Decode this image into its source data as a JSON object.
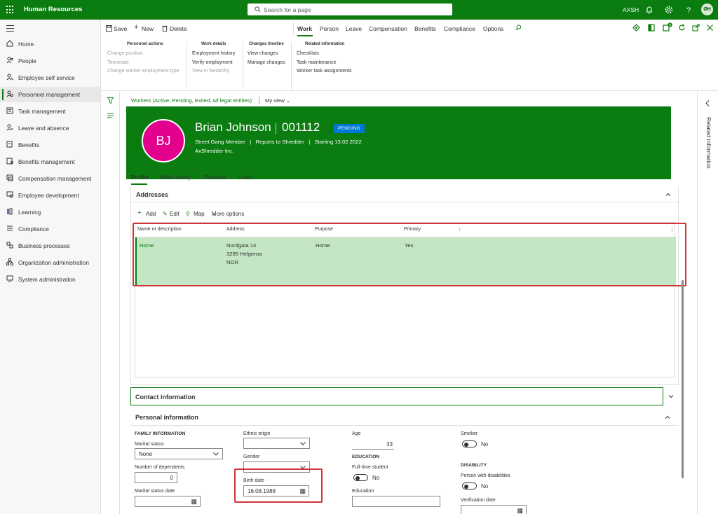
{
  "app": {
    "title": "Human Resources",
    "company": "AXSH",
    "user_initials": "ØH"
  },
  "search": {
    "placeholder": "Search for a page"
  },
  "nav": {
    "items": [
      {
        "label": "Home",
        "icon": "home-icon"
      },
      {
        "label": "People",
        "icon": "people-icon"
      },
      {
        "label": "Employee self service",
        "icon": "person-icon"
      },
      {
        "label": "Personnel management",
        "icon": "personnel-icon",
        "active": true
      },
      {
        "label": "Task management",
        "icon": "task-icon"
      },
      {
        "label": "Leave and absence",
        "icon": "leave-icon"
      },
      {
        "label": "Benefits",
        "icon": "benefits-icon"
      },
      {
        "label": "Benefits management",
        "icon": "benefits-mgmt-icon"
      },
      {
        "label": "Compensation management",
        "icon": "compensation-icon"
      },
      {
        "label": "Employee development",
        "icon": "development-icon"
      },
      {
        "label": "Learning",
        "icon": "learning-icon"
      },
      {
        "label": "Compliance",
        "icon": "compliance-icon"
      },
      {
        "label": "Business processes",
        "icon": "process-icon"
      },
      {
        "label": "Organization administration",
        "icon": "org-icon"
      },
      {
        "label": "System administration",
        "icon": "system-icon"
      }
    ]
  },
  "actionpane": {
    "save": "Save",
    "new": "New",
    "delete": "Delete",
    "tabs": [
      "Work",
      "Person",
      "Leave",
      "Compensation",
      "Benefits",
      "Compliance",
      "Options"
    ],
    "groups": {
      "personnel_actions": {
        "title": "Personnel actions",
        "items": [
          "Change position",
          "Terminate",
          "Change worker employment type"
        ]
      },
      "work_details": {
        "title": "Work details",
        "items": [
          "Employment history",
          "Verify employment",
          "View in hierarchy"
        ]
      },
      "changes_timeline": {
        "title": "Changes timeline",
        "items": [
          "View changes",
          "Manage changes"
        ]
      },
      "related_information": {
        "title": "Related information",
        "items": [
          "Checklists",
          "Task maintenance",
          "Worker task assignments"
        ]
      }
    }
  },
  "breadcrumb": {
    "filter": "Workers (Active, Pending, Exited, All legal entities)",
    "view": "My view"
  },
  "worker": {
    "initials": "BJ",
    "name": "Brian Johnson",
    "number": "001112",
    "status": "PENDING",
    "subtitle": "Street Gang Member   |   Reports to Shredder   |   Starting 13.02.2022",
    "company": "AxShredder Inc."
  },
  "form_tabs": [
    "Profile",
    "Work history",
    "Positions",
    "Links"
  ],
  "addresses": {
    "title": "Addresses",
    "tools": {
      "add": "Add",
      "edit": "Edit",
      "map": "Map",
      "more": "More options"
    },
    "columns": [
      "Name or description",
      "Address",
      "Purpose",
      "Primary"
    ],
    "rows": [
      {
        "name": "Home",
        "address_lines": [
          "Nordgata 14",
          "3295 Helgeroa",
          "NOR"
        ],
        "purpose": "Home",
        "primary": "Yes"
      }
    ]
  },
  "contact": {
    "title": "Contact information"
  },
  "personal": {
    "title": "Personal information",
    "family_head": "FAMILY INFORMATION",
    "marital_status_label": "Marital status",
    "marital_status_value": "None",
    "dependents_label": "Number of dependents",
    "dependents_value": "0",
    "marital_date_label": "Marital status date",
    "ethnic_label": "Ethnic origin",
    "gender_label": "Gender",
    "birth_label": "Birth date",
    "birth_value": "16.08.1988",
    "age_label": "Age",
    "age_value": "33",
    "education_head": "EDUCATION",
    "fulltime_label": "Full-time student",
    "fulltime_value": "No",
    "education_label": "Education",
    "smoker_label": "Smoker",
    "smoker_value": "No",
    "disability_head": "DISABILITY",
    "disabled_label": "Person with disabilities",
    "disabled_value": "No",
    "verification_label": "Verification date"
  },
  "right_pane": {
    "label": "Related information"
  },
  "colors": {
    "brand": "#0b7c10",
    "status": "#0078d4",
    "avatar": "#e3008c",
    "highlight": "#d13438"
  }
}
